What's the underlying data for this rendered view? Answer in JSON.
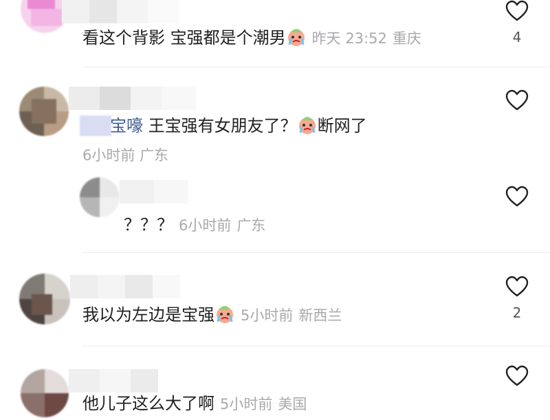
{
  "comments": [
    {
      "text": "看这个背影 宝强都是个潮男",
      "time": "昨天 23:52",
      "location": "重庆",
      "likes": "4"
    },
    {
      "mention": "宝嚎",
      "text": "王宝强有女朋友了？",
      "text_after_emoji": "断网了",
      "time": "6小时前",
      "location": "广东"
    },
    {
      "text": "？？？",
      "time": "6小时前",
      "location": "广东"
    },
    {
      "text": "我以为左边是宝强",
      "time": "5小时前",
      "location": "新西兰",
      "likes": "2"
    },
    {
      "text": "他儿子这么大了啊",
      "time": "5小时前",
      "location": "美国"
    }
  ],
  "icons": {
    "like": "heart-outline-icon",
    "emoji": "crying-face-emoji"
  },
  "colors": {
    "meta": "#a9a9ad",
    "text": "#1f1f1f",
    "mention": "#3d5b8f"
  }
}
